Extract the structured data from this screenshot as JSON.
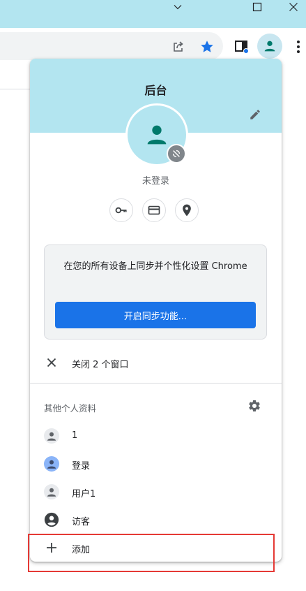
{
  "browser": {
    "window_controls": [
      "chevron-down-icon",
      "maximize-icon",
      "close-icon"
    ],
    "toolbar_icons": [
      "share-icon",
      "bookmark-star-icon",
      "side-panel-icon",
      "profile-avatar-icon",
      "more-vert-icon"
    ],
    "accent_color": "#1a73e8",
    "star_color": "#1a73e8"
  },
  "profile_menu": {
    "name": "后台",
    "status": "未登录",
    "quick_actions": [
      "key-icon",
      "credit-card-icon",
      "location-pin-icon"
    ],
    "sync_prompt": "在您的所有设备上同步并个性化设置 Chrome",
    "sync_button": "开启同步功能...",
    "close_windows": "关闭 2 个窗口",
    "other_profiles_title": "其他个人资料",
    "profiles": [
      {
        "label": "1",
        "icon": "person-icon"
      },
      {
        "label": "登录",
        "icon": "person-icon"
      },
      {
        "label": "用户1",
        "icon": "person-icon"
      },
      {
        "label": "访客",
        "icon": "guest-icon"
      }
    ],
    "add_label": "添加",
    "header_color": "#b3e5f0",
    "highlight_color": "#e53935"
  }
}
